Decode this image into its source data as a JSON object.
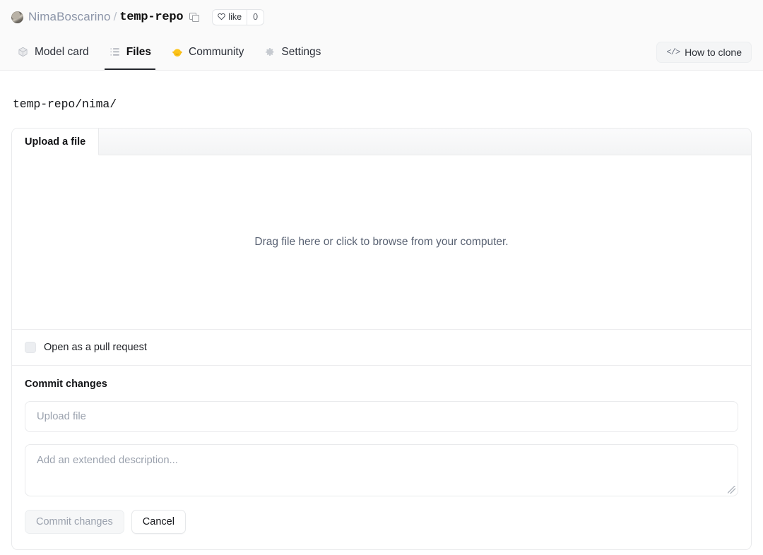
{
  "header": {
    "owner": "NimaBoscarino",
    "separator": "/",
    "repo": "temp-repo",
    "copy_icon": "copy-icon",
    "like_label": "like",
    "like_count": "0",
    "heart_icon": "heart-icon",
    "avatar": "user-avatar"
  },
  "nav": {
    "tabs": [
      {
        "label": "Model card",
        "icon": "cube-icon",
        "active": false
      },
      {
        "label": "Files",
        "icon": "file-list-icon",
        "active": true
      },
      {
        "label": "Community",
        "icon": "hugging-face-icon",
        "active": false
      },
      {
        "label": "Settings",
        "icon": "gear-icon",
        "active": false
      }
    ],
    "clone_button": {
      "label": "How to clone",
      "icon": "code-icon"
    }
  },
  "path": "temp-repo/nima/",
  "upload_card": {
    "tab_label": "Upload a file",
    "dropzone_text": "Drag file here or click to browse from your computer.",
    "pull_request": {
      "label": "Open as a pull request",
      "checked": false
    },
    "commit": {
      "title": "Commit changes",
      "summary_placeholder": "Upload file",
      "summary_value": "",
      "description_placeholder": "Add an extended description...",
      "description_value": "",
      "submit_label": "Commit changes",
      "cancel_label": "Cancel"
    }
  },
  "colors": {
    "accent_dark": "#23262c",
    "owner_text": "#8c95a8",
    "placeholder": "#9ba2ae",
    "border": "#e9eaec",
    "header_bg": "#fafafa"
  }
}
